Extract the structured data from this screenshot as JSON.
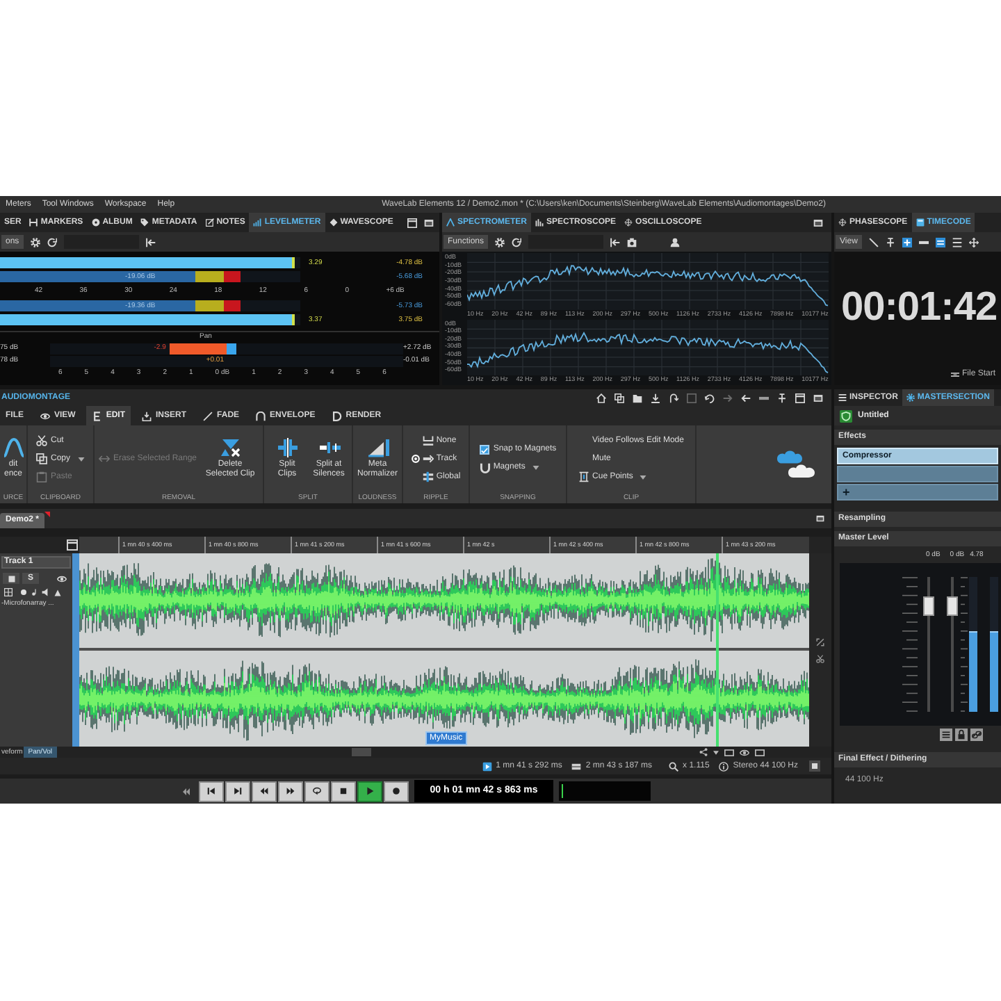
{
  "menu_bar": {
    "menus": [
      "Meters",
      "Tool Windows",
      "Workspace",
      "Help"
    ],
    "title": "WaveLab Elements 12 / Demo2.mon * (C:\\Users\\ken\\Documents\\Steinberg\\WaveLab Elements\\Audiomontages\\Demo2)"
  },
  "level_meter_panel": {
    "tabs": [
      {
        "label": "SER",
        "selected": false
      },
      {
        "label": "MARKERS",
        "selected": false
      },
      {
        "label": "ALBUM",
        "selected": false
      },
      {
        "label": "METADATA",
        "selected": false
      },
      {
        "label": "NOTES",
        "selected": false
      },
      {
        "label": "LEVELMETER",
        "selected": true
      },
      {
        "label": "WAVESCOPE",
        "selected": false
      }
    ],
    "toolbar_button": "ons",
    "meters": [
      {
        "kind": "peak",
        "level": 0.98,
        "reading": "3.29",
        "value": "-4.78 dB"
      },
      {
        "kind": "rms",
        "level": 0.8,
        "reading": "-19.06 dB",
        "value": "-5.68 dB"
      },
      {
        "kind": "rms",
        "level": 0.8,
        "reading": "-19.36 dB",
        "value": "-5.73 dB"
      },
      {
        "kind": "peak",
        "level": 0.98,
        "reading": "3.37",
        "value": "3.75 dB"
      }
    ],
    "scale": [
      "42",
      "36",
      "30",
      "24",
      "18",
      "12",
      "6",
      "0",
      "+6 dB"
    ],
    "pan": {
      "title": "Pan",
      "rows": [
        {
          "left": "75 dB",
          "marker": "-2.9",
          "level": 0.32,
          "right": "+2.72 dB"
        },
        {
          "left": "78 dB",
          "marker": "+0.01",
          "right": "-0.01 dB"
        }
      ],
      "scale": [
        "6",
        "5",
        "4",
        "3",
        "2",
        "1",
        "0 dB",
        "1",
        "2",
        "3",
        "4",
        "5",
        "6"
      ]
    }
  },
  "spectrum_panel": {
    "tabs": [
      {
        "label": "SPECTROMETER",
        "selected": true
      },
      {
        "label": "SPECTROSCOPE",
        "selected": false
      },
      {
        "label": "OSCILLOSCOPE",
        "selected": false
      }
    ],
    "toolbar_button": "Functions",
    "graphs": [
      {
        "y_labels": [
          "0dB",
          "-10dB",
          "-20dB",
          "-30dB",
          "-40dB",
          "-50dB",
          "-60dB"
        ],
        "x_labels": [
          "10 Hz",
          "20 Hz",
          "42 Hz",
          "89 Hz",
          "113 Hz",
          "200 Hz",
          "297 Hz",
          "500 Hz",
          "1126 Hz",
          "2733 Hz",
          "4126 Hz",
          "7898 Hz",
          "10177 Hz"
        ]
      },
      {
        "y_labels": [
          "0dB",
          "-10dB",
          "-20dB",
          "-30dB",
          "-40dB",
          "-50dB",
          "-60dB"
        ],
        "x_labels": [
          "10 Hz",
          "20 Hz",
          "42 Hz",
          "89 Hz",
          "113 Hz",
          "200 Hz",
          "297 Hz",
          "500 Hz",
          "1126 Hz",
          "2733 Hz",
          "4126 Hz",
          "7898 Hz",
          "10177 Hz"
        ]
      }
    ]
  },
  "timecode_panel": {
    "tabs": [
      {
        "label": "PHASESCOPE",
        "selected": false
      },
      {
        "label": "TIMECODE",
        "selected": true
      }
    ],
    "toolbar_button": "View",
    "time": "00:01:42",
    "origin": "File Start"
  },
  "montage": {
    "title": "AUDIOMONTAGE",
    "ribbon_tabs": [
      {
        "label": "FILE",
        "selected": false
      },
      {
        "label": "VIEW",
        "selected": false
      },
      {
        "label": "EDIT",
        "selected": true
      },
      {
        "label": "INSERT",
        "selected": false
      },
      {
        "label": "FADE",
        "selected": false
      },
      {
        "label": "ENVELOPE",
        "selected": false
      },
      {
        "label": "RENDER",
        "selected": false
      }
    ],
    "ribbon_groups": [
      {
        "label": "URCE",
        "items": [
          {
            "kind": "large",
            "label": "dit ence"
          }
        ]
      },
      {
        "label": "CLIPBOARD",
        "items": [
          {
            "kind": "small",
            "label": "Cut",
            "disabled": false
          },
          {
            "kind": "menu",
            "label": "Copy",
            "disabled": false
          },
          {
            "kind": "small",
            "label": "Paste",
            "disabled": true
          }
        ]
      },
      {
        "label": "REMOVAL",
        "items": [
          {
            "kind": "small",
            "label": "Erase Selected Range",
            "disabled": true
          },
          {
            "kind": "large",
            "label": "Delete Selected Clip",
            "disabled": false
          }
        ]
      },
      {
        "label": "SPLIT",
        "items": [
          {
            "kind": "large",
            "label": "Split Clips"
          },
          {
            "kind": "large",
            "label": "Split at Silences"
          }
        ]
      },
      {
        "label": "LOUDNESS",
        "items": [
          {
            "kind": "large",
            "label": "Meta Normalizer"
          }
        ]
      },
      {
        "label": "RIPPLE",
        "items": [
          {
            "kind": "radio",
            "label": "None",
            "selected": false
          },
          {
            "kind": "radio",
            "label": "Track",
            "selected": true
          },
          {
            "kind": "radio",
            "label": "Global",
            "selected": false
          }
        ]
      },
      {
        "label": "SNAPPING",
        "items": [
          {
            "kind": "checkbox",
            "label": "Snap to Magnets",
            "checked": true
          },
          {
            "kind": "menu",
            "label": "Magnets"
          }
        ]
      },
      {
        "label": "CLIP",
        "items": [
          {
            "kind": "small",
            "label": "Video Follows Edit Mode"
          },
          {
            "kind": "small",
            "label": "Mute"
          },
          {
            "kind": "menu",
            "label": "Cue Points"
          }
        ]
      }
    ],
    "document_tabs": [
      {
        "label": "Demo2 *",
        "selected": true
      }
    ],
    "ruler": [
      "1 mn 40 s 400 ms",
      "1 mn 40 s 800 ms",
      "1 mn 41 s 200 ms",
      "1 mn 41 s 600 ms",
      "1 mn 42 s",
      "1 mn 42 s 400 ms",
      "1 mn 42 s 800 ms",
      "1 mn 43 s 200 ms"
    ],
    "track": {
      "name": "Track 1",
      "solo_button": "S",
      "source": "-Microfonarray ..."
    },
    "clip": {
      "label": "MyMusic"
    },
    "lane_tabs": [
      {
        "label": "veform",
        "selected": false
      },
      {
        "label": "Pan/Vol",
        "selected": true
      }
    ],
    "status": [
      "1 mn 41 s 292 ms",
      "2 mn 43 s 187 ms",
      "x 1.115",
      "Stereo 44 100 Hz"
    ]
  },
  "transport": {
    "buttons": [
      {
        "kind": "start",
        "active": false
      },
      {
        "kind": "end",
        "active": false
      },
      {
        "kind": "rewind",
        "active": false
      },
      {
        "kind": "forward",
        "active": false
      },
      {
        "kind": "loop",
        "active": false
      },
      {
        "kind": "stop",
        "active": false
      },
      {
        "kind": "play",
        "active": true
      },
      {
        "kind": "record",
        "active": false
      }
    ],
    "time": "00 h 01 mn 42 s 863 ms"
  },
  "inspector": {
    "tabs": [
      {
        "label": "INSPECTOR",
        "selected": false
      },
      {
        "label": "MASTERSECTION",
        "selected": true
      }
    ],
    "preset": "Untitled",
    "effects": {
      "title": "Effects",
      "slots": [
        {
          "kind": "plugin",
          "label": "Compressor",
          "selected": true
        },
        {
          "kind": "empty",
          "selected": false
        },
        {
          "kind": "add",
          "label": "+",
          "selected": false
        }
      ]
    },
    "resampling": {
      "title": "Resampling"
    },
    "master_level": {
      "title": "Master Level",
      "readings": [
        "0 dB",
        "0 dB",
        "4.78"
      ],
      "faders": [
        {
          "level": 0.78
        },
        {
          "level": 0.78
        }
      ],
      "meters": [
        {
          "level": 0.6
        },
        {
          "level": 0.6
        }
      ]
    },
    "final_effect": {
      "title": "Final Effect / Dithering",
      "value": "44 100 Hz"
    }
  }
}
